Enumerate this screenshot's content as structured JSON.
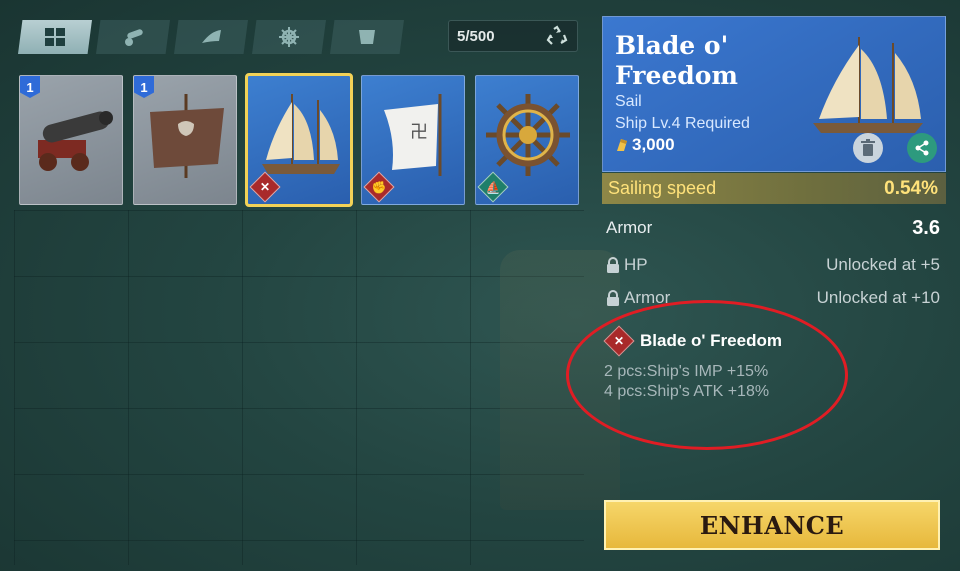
{
  "tabs": [
    {
      "name": "all",
      "icon": "grid-icon",
      "active": true
    },
    {
      "name": "cannon",
      "icon": "cannon-icon",
      "active": false
    },
    {
      "name": "sail",
      "icon": "sail-icon",
      "active": false
    },
    {
      "name": "helm",
      "icon": "helm-icon",
      "active": false
    },
    {
      "name": "flag",
      "icon": "flag-icon",
      "active": false
    }
  ],
  "inventory": {
    "capacity": "5/500",
    "recycle_icon": "recycle-icon"
  },
  "items": [
    {
      "count": "1",
      "kind": "cannon",
      "rarity": "gray"
    },
    {
      "count": "1",
      "kind": "tattered-sail",
      "rarity": "gray"
    },
    {
      "count": "",
      "kind": "sail",
      "rarity": "blue",
      "selected": true,
      "set_icon": "crossed-swords-icon"
    },
    {
      "count": "",
      "kind": "white-sail",
      "rarity": "blue",
      "set_icon": "fist-icon"
    },
    {
      "count": "",
      "kind": "helm",
      "rarity": "blue",
      "set_icon": "ship-icon"
    }
  ],
  "detail": {
    "name": "Blade o' Freedom",
    "type": "Sail",
    "requirement": "Ship Lv.4 Required",
    "cost": "3,000",
    "primary_stat": {
      "label": "Sailing speed",
      "value": "0.54%"
    },
    "stats": [
      {
        "label": "Armor",
        "value": "3.6"
      }
    ],
    "locked_stats": [
      {
        "label": "HP",
        "value": "Unlocked at +5"
      },
      {
        "label": "Armor",
        "value": "Unlocked at +10"
      }
    ],
    "set": {
      "name": "Blade o' Freedom",
      "bonuses": [
        "2 pcs:Ship's IMP +15%",
        "4 pcs:Ship's ATK +18%"
      ]
    }
  },
  "actions": {
    "enhance_label": "ENHANCE"
  },
  "colors": {
    "accent_gold": "#f2d257",
    "rare_blue": "#3b78d0",
    "highlight_ring": "#e01d24"
  }
}
